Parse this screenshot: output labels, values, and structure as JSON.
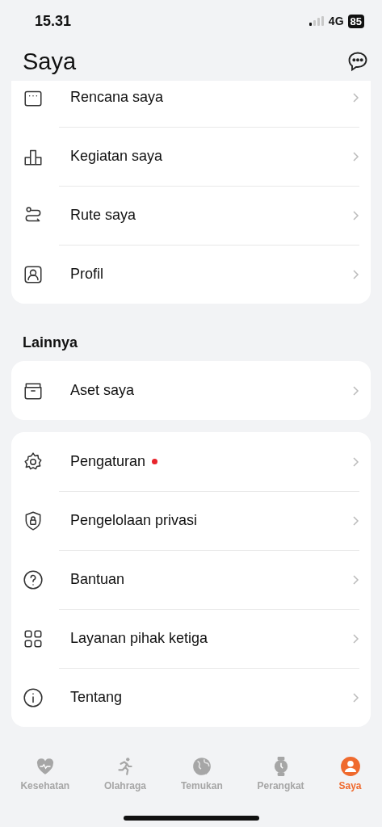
{
  "status_bar": {
    "time": "15.31",
    "network": "4G",
    "battery": "85"
  },
  "header": {
    "title": "Saya"
  },
  "groups": [
    {
      "items": [
        {
          "label": "Rencana saya",
          "dot": false
        },
        {
          "label": "Kegiatan saya",
          "dot": false
        },
        {
          "label": "Rute saya",
          "dot": false
        },
        {
          "label": "Profil",
          "dot": false
        }
      ]
    },
    {
      "heading": "Lainnya",
      "items": [
        {
          "label": "Aset saya",
          "dot": false
        }
      ]
    },
    {
      "items": [
        {
          "label": "Pengaturan",
          "dot": true
        },
        {
          "label": "Pengelolaan privasi",
          "dot": false
        },
        {
          "label": "Bantuan",
          "dot": false
        },
        {
          "label": "Layanan pihak ketiga",
          "dot": false
        },
        {
          "label": "Tentang",
          "dot": false
        }
      ]
    }
  ],
  "tabs": [
    {
      "label": "Kesehatan",
      "selected": false
    },
    {
      "label": "Olahraga",
      "selected": false
    },
    {
      "label": "Temukan",
      "selected": false
    },
    {
      "label": "Perangkat",
      "selected": false
    },
    {
      "label": "Saya",
      "selected": true
    }
  ]
}
